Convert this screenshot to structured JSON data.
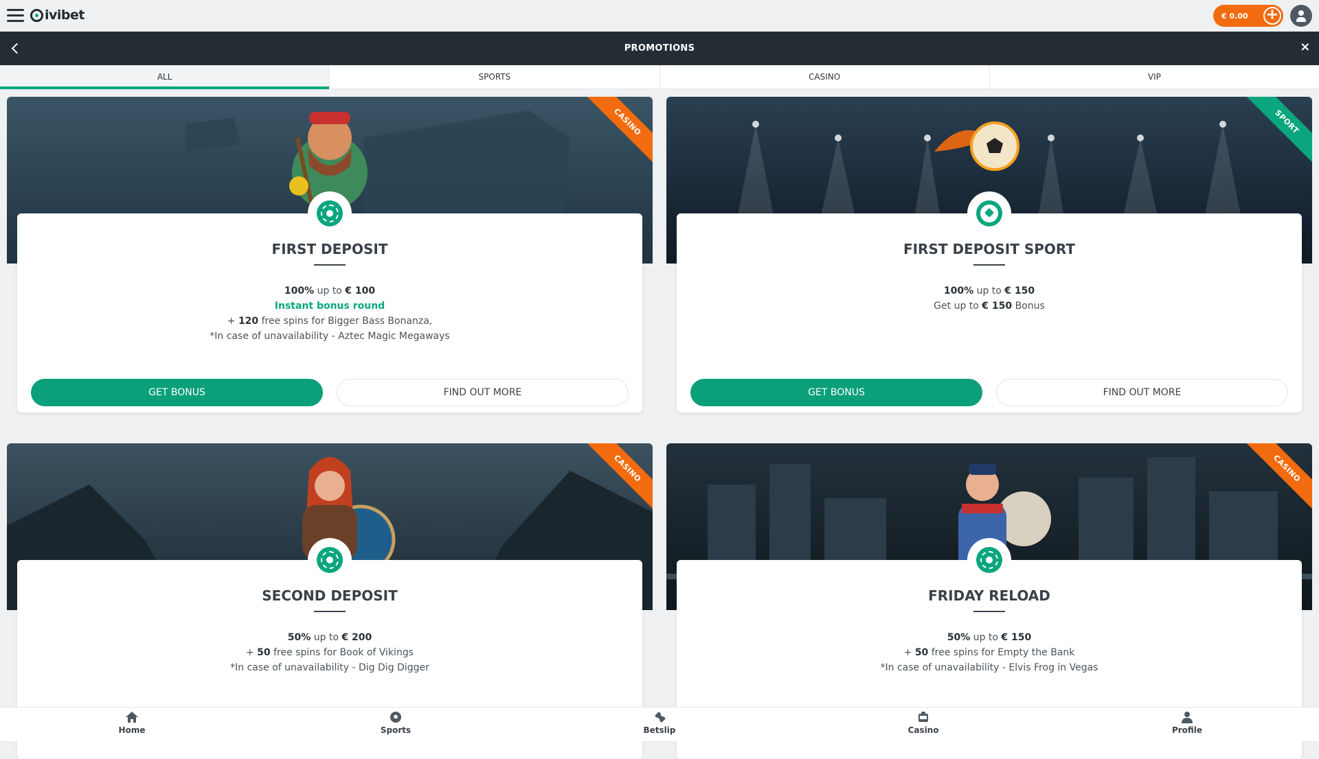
{
  "topbar": {
    "logo": "ivibet",
    "balance": "€ 0.00",
    "menu_icon": "hamburger-menu-icon",
    "add_funds_icon": "plus-icon",
    "user_icon": "user-icon"
  },
  "header": {
    "title": "PROMOTIONS"
  },
  "tabs": [
    {
      "label": "ALL",
      "active": true
    },
    {
      "label": "SPORTS",
      "active": false
    },
    {
      "label": "CASINO",
      "active": false
    },
    {
      "label": "VIP",
      "active": false
    }
  ],
  "cards": [
    {
      "tag": "CASINO",
      "title": "FIRST DEPOSIT",
      "line1_pct": "100%",
      "line1_mid": " up to ",
      "line1_amt": "€ 100",
      "line2_green": "Instant bonus round",
      "line3_pre": "+ ",
      "line3_num": "120",
      "line3_text": " free spins for Bigger Bass Bonanza,",
      "line4": "*In case of unavailability - Aztec Magic Megaways",
      "get_bonus": "GET BONUS",
      "find_out": "FIND OUT MORE"
    },
    {
      "tag": "SPORT",
      "title": "FIRST DEPOSIT SPORT",
      "line1_pct": "100%",
      "line1_mid": " up to ",
      "line1_amt": "€ 150",
      "line2_pre": "Get up to ",
      "line2_amt": "€ 150",
      "line2_post": " Bonus",
      "get_bonus": "GET BONUS",
      "find_out": "FIND OUT MORE"
    },
    {
      "tag": "CASINO",
      "title": "SECOND DEPOSIT",
      "line1_pct": "50%",
      "line1_mid": " up to ",
      "line1_amt": "€ 200",
      "line2_pre": "+ ",
      "line2_num": "50",
      "line2_text": " free spins for Book of Vikings",
      "line3": "*In case of unavailability - Dig Dig Digger"
    },
    {
      "tag": "CASINO",
      "title": "FRIDAY RELOAD",
      "line1_pct": "50%",
      "line1_mid": " up to ",
      "line1_amt": "€ 150",
      "line2_pre": "+ ",
      "line2_num": "50",
      "line2_text": " free spins for Empty the Bank",
      "line3": "*In case of unavailability - Elvis Frog in Vegas"
    }
  ],
  "bottom_nav": [
    {
      "label": "Home",
      "icon": "home-icon"
    },
    {
      "label": "Sports",
      "icon": "soccer-ball-icon"
    },
    {
      "label": "Betslip",
      "icon": "ticket-icon"
    },
    {
      "label": "Casino",
      "icon": "slot-machine-icon"
    },
    {
      "label": "Profile",
      "icon": "user-icon"
    }
  ],
  "colors": {
    "accent": "#0aa67e",
    "orange": "#f26b0f",
    "header_bg": "#232d33"
  }
}
